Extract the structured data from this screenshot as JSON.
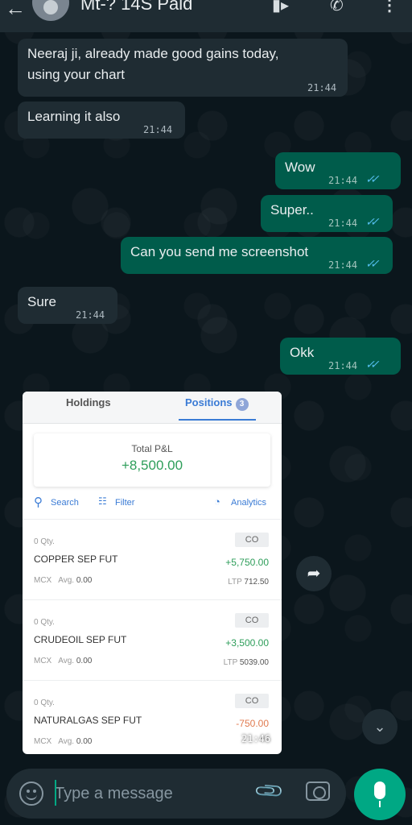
{
  "header": {
    "title": "Mt-? 14S Paid",
    "icons": [
      "back-arrow-icon",
      "avatar",
      "video-call-icon",
      "voice-call-icon",
      "menu-icon"
    ]
  },
  "messages": [
    {
      "direction": "in",
      "text": "Neeraj ji, already made good gains today, using your chart",
      "time": "21:44"
    },
    {
      "direction": "in",
      "text": "Learning it also",
      "time": "21:44"
    },
    {
      "direction": "out",
      "text": "Wow",
      "time": "21:44",
      "ticks": "read"
    },
    {
      "direction": "out",
      "text": "Super..",
      "time": "21:44",
      "ticks": "read"
    },
    {
      "direction": "out",
      "text": "Can you send me screenshot",
      "time": "21:44",
      "ticks": "read"
    },
    {
      "direction": "in",
      "text": "Sure",
      "time": "21:44"
    },
    {
      "direction": "out",
      "text": "Okk",
      "time": "21:44",
      "ticks": "read"
    }
  ],
  "image_message": {
    "time": "21:46",
    "tabs": [
      "Holdings",
      "Positions"
    ],
    "positions_count": "3",
    "total_pnl_label": "Total P&L",
    "total_pnl_value": "+8,500.00",
    "toolbar": {
      "search": "Search",
      "filter": "Filter",
      "analytics": "Analytics"
    },
    "rows": [
      {
        "qty": "0 Qty.",
        "product": "CO",
        "symbol": "COPPER SEP FUT",
        "pnl": "+5,750.00",
        "exchange": "MCX",
        "avg_label": "Avg.",
        "avg": "0.00",
        "ltp_label": "LTP",
        "ltp": "712.50"
      },
      {
        "qty": "0 Qty.",
        "product": "CO",
        "symbol": "CRUDEOIL SEP FUT",
        "pnl": "+3,500.00",
        "exchange": "MCX",
        "avg_label": "Avg.",
        "avg": "0.00",
        "ltp_label": "LTP",
        "ltp": "5039.00"
      },
      {
        "qty": "0 Qty.",
        "product": "CO",
        "symbol": "NATURALGAS SEP FUT",
        "pnl": "-750.00",
        "exchange": "MCX",
        "avg_label": "Avg.",
        "avg": "0.00",
        "ltp_label": "",
        "ltp": ""
      }
    ],
    "colors": {
      "profit": "#2e9e5a",
      "loss": "#e07a4f",
      "accent": "#3a7bd5"
    }
  },
  "input": {
    "placeholder": "Type a message"
  },
  "colors": {
    "incoming_bubble": "#1f2c33",
    "outgoing_bubble": "#005c4b",
    "read_ticks": "#53bdeb",
    "mic_button": "#00a884"
  }
}
